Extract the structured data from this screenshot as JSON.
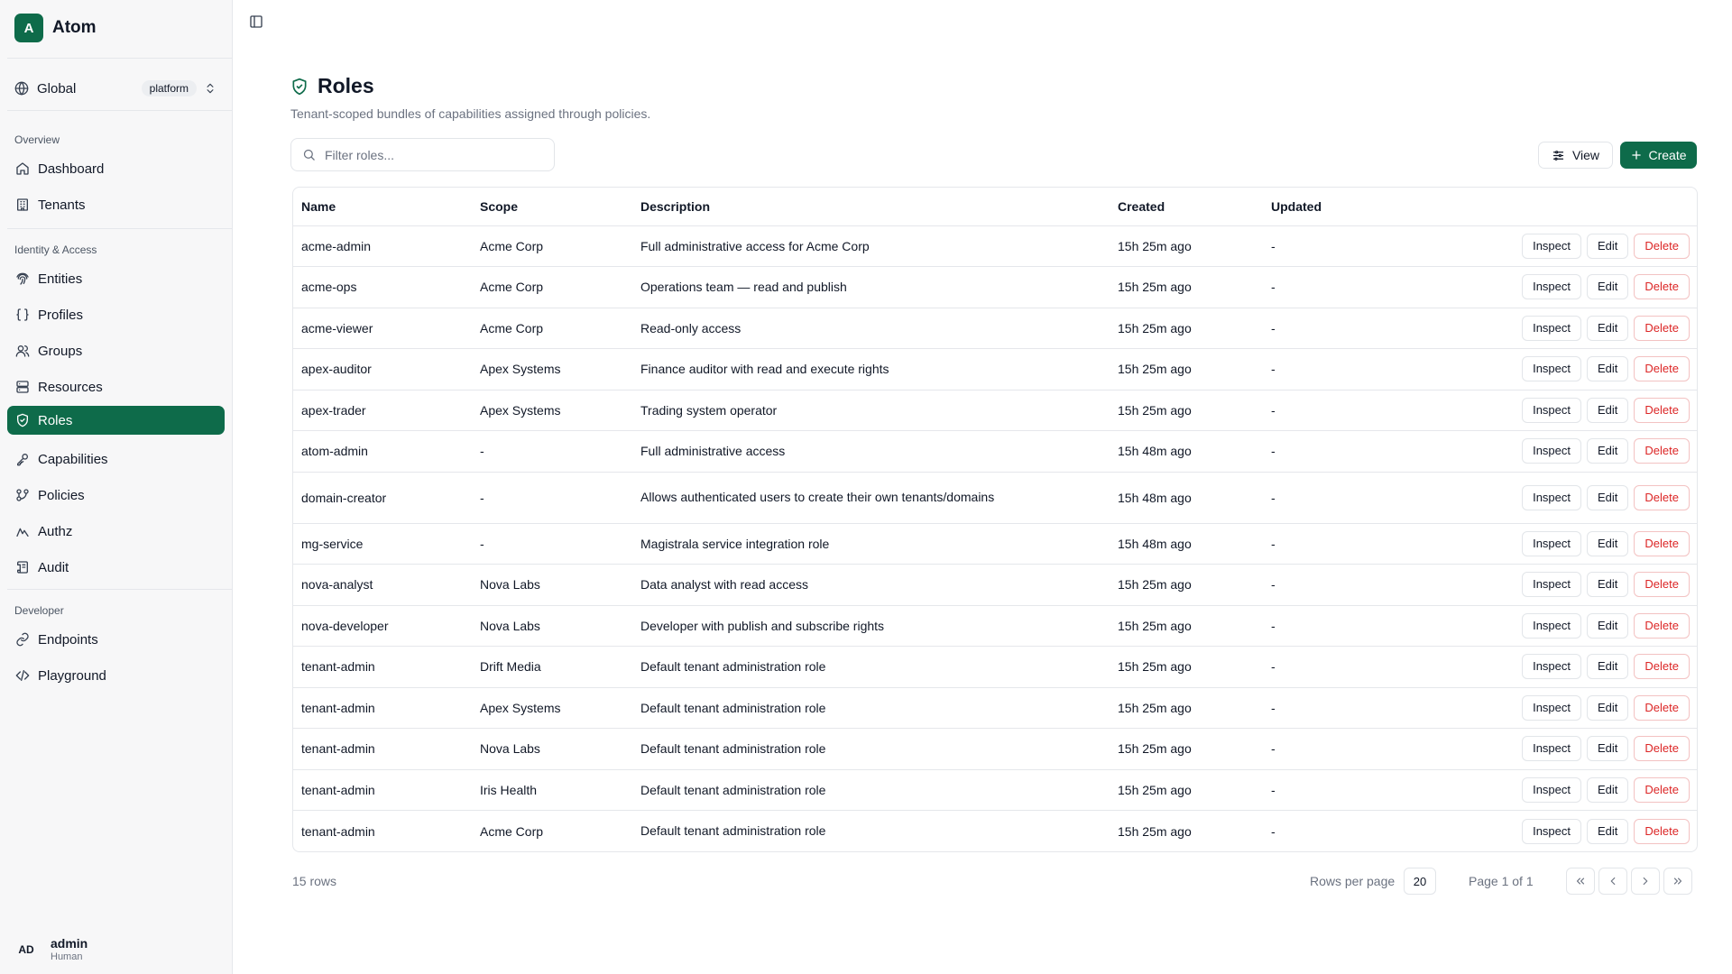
{
  "app": {
    "logo_letter": "A",
    "name": "Atom"
  },
  "scope": {
    "label": "Global",
    "badge": "platform"
  },
  "sidebar": {
    "sections": [
      {
        "label": "Overview",
        "items": [
          {
            "label": "Dashboard",
            "icon": "home-icon"
          },
          {
            "label": "Tenants",
            "icon": "building-icon"
          }
        ]
      },
      {
        "label": "Identity & Access",
        "items": [
          {
            "label": "Entities",
            "icon": "fingerprint-icon"
          },
          {
            "label": "Profiles",
            "icon": "braces-icon"
          },
          {
            "label": "Groups",
            "icon": "users-icon"
          },
          {
            "label": "Resources",
            "icon": "server-icon"
          },
          {
            "label": "Roles",
            "icon": "shield-check-icon",
            "active": true
          },
          {
            "label": "Capabilities",
            "icon": "key-icon"
          },
          {
            "label": "Policies",
            "icon": "git-branch-icon"
          },
          {
            "label": "Authz",
            "icon": "activity-icon"
          },
          {
            "label": "Audit",
            "icon": "scroll-icon"
          }
        ]
      },
      {
        "label": "Developer",
        "items": [
          {
            "label": "Endpoints",
            "icon": "link-icon"
          },
          {
            "label": "Playground",
            "icon": "code-icon"
          }
        ]
      }
    ]
  },
  "user": {
    "initials": "AD",
    "name": "admin",
    "kind": "Human"
  },
  "page": {
    "title": "Roles",
    "subtitle": "Tenant-scoped bundles of capabilities assigned through policies.",
    "filter_placeholder": "Filter roles...",
    "view_label": "View",
    "create_label": "Create"
  },
  "table": {
    "columns": [
      "Name",
      "Scope",
      "Description",
      "Created",
      "Updated"
    ],
    "actions": {
      "inspect": "Inspect",
      "edit": "Edit",
      "delete": "Delete"
    },
    "rows": [
      {
        "name": "acme-admin",
        "scope": "Acme Corp",
        "description": "Full administrative access for Acme Corp",
        "created": "15h 25m ago",
        "updated": "-"
      },
      {
        "name": "acme-ops",
        "scope": "Acme Corp",
        "description": "Operations team — read and publish",
        "created": "15h 25m ago",
        "updated": "-"
      },
      {
        "name": "acme-viewer",
        "scope": "Acme Corp",
        "description": "Read-only access",
        "created": "15h 25m ago",
        "updated": "-"
      },
      {
        "name": "apex-auditor",
        "scope": "Apex Systems",
        "description": "Finance auditor with read and execute rights",
        "created": "15h 25m ago",
        "updated": "-"
      },
      {
        "name": "apex-trader",
        "scope": "Apex Systems",
        "description": "Trading system operator",
        "created": "15h 25m ago",
        "updated": "-"
      },
      {
        "name": "atom-admin",
        "scope": "-",
        "description": "Full administrative access",
        "created": "15h 48m ago",
        "updated": "-"
      },
      {
        "name": "domain-creator",
        "scope": "-",
        "description": "Allows authenticated users to create their own tenants/domains",
        "created": "15h 48m ago",
        "updated": "-"
      },
      {
        "name": "mg-service",
        "scope": "-",
        "description": "Magistrala service integration role",
        "created": "15h 48m ago",
        "updated": "-"
      },
      {
        "name": "nova-analyst",
        "scope": "Nova Labs",
        "description": "Data analyst with read access",
        "created": "15h 25m ago",
        "updated": "-"
      },
      {
        "name": "nova-developer",
        "scope": "Nova Labs",
        "description": "Developer with publish and subscribe rights",
        "created": "15h 25m ago",
        "updated": "-"
      },
      {
        "name": "tenant-admin",
        "scope": "Drift Media",
        "description": "Default tenant administration role",
        "created": "15h 25m ago",
        "updated": "-"
      },
      {
        "name": "tenant-admin",
        "scope": "Apex Systems",
        "description": "Default tenant administration role",
        "created": "15h 25m ago",
        "updated": "-"
      },
      {
        "name": "tenant-admin",
        "scope": "Nova Labs",
        "description": "Default tenant administration role",
        "created": "15h 25m ago",
        "updated": "-"
      },
      {
        "name": "tenant-admin",
        "scope": "Iris Health",
        "description": "Default tenant administration role",
        "created": "15h 25m ago",
        "updated": "-"
      },
      {
        "name": "tenant-admin",
        "scope": "Acme Corp",
        "description": "Default tenant administration role",
        "created": "15h 25m ago",
        "updated": "-"
      }
    ]
  },
  "pagination": {
    "row_count": "15 rows",
    "rows_per_page_label": "Rows per page",
    "rows_per_page": "20",
    "page_label": "Page 1 of 1"
  },
  "colors": {
    "accent": "#0e6b4a",
    "danger": "#dc2626",
    "muted": "#6b7280",
    "border": "#e5e7eb"
  }
}
